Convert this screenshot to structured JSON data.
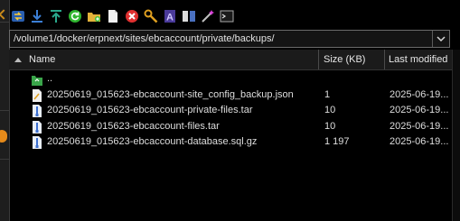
{
  "toolbar": {
    "buttons": [
      {
        "name": "connect-icon",
        "color": "#3b7fd6"
      },
      {
        "name": "download-icon",
        "color": "#3b7fd6"
      },
      {
        "name": "upload-icon",
        "color": "#2aa98d"
      },
      {
        "name": "refresh-icon",
        "color": "#3ecf3e"
      },
      {
        "name": "new-folder-icon",
        "color": "#e2b23a"
      },
      {
        "name": "new-file-icon",
        "color": "#e8e8e8"
      },
      {
        "name": "delete-icon",
        "color": "#e03030"
      },
      {
        "name": "properties-icon",
        "color": "#e0a020"
      },
      {
        "name": "text-editor-icon",
        "color": "#6a4fbf"
      },
      {
        "name": "compare-icon",
        "color": "#4a70c0"
      },
      {
        "name": "magic-wand-icon",
        "color": "#d04fd0"
      },
      {
        "name": "terminal-icon",
        "color": "#888888"
      }
    ]
  },
  "pathbar": {
    "value": "/volume1/docker/erpnext/sites/ebcaccount/private/backups/"
  },
  "columns": {
    "name": "Name",
    "size": "Size (KB)",
    "modified": "Last modified"
  },
  "files": [
    {
      "name": "..",
      "size": "",
      "modified": "",
      "icon": "parent-folder-icon"
    },
    {
      "name": "20250619_015623-ebcaccount-site_config_backup.json",
      "size": "1",
      "modified": "2025-06-19...",
      "icon": "json-file-icon"
    },
    {
      "name": "20250619_015623-ebcaccount-private-files.tar",
      "size": "10",
      "modified": "2025-06-19...",
      "icon": "archive-file-icon"
    },
    {
      "name": "20250619_015623-ebcaccount-files.tar",
      "size": "10",
      "modified": "2025-06-19...",
      "icon": "archive-file-icon"
    },
    {
      "name": "20250619_015623-ebcaccount-database.sql.gz",
      "size": "1 197",
      "modified": "2025-06-19...",
      "icon": "archive-file-icon"
    }
  ]
}
